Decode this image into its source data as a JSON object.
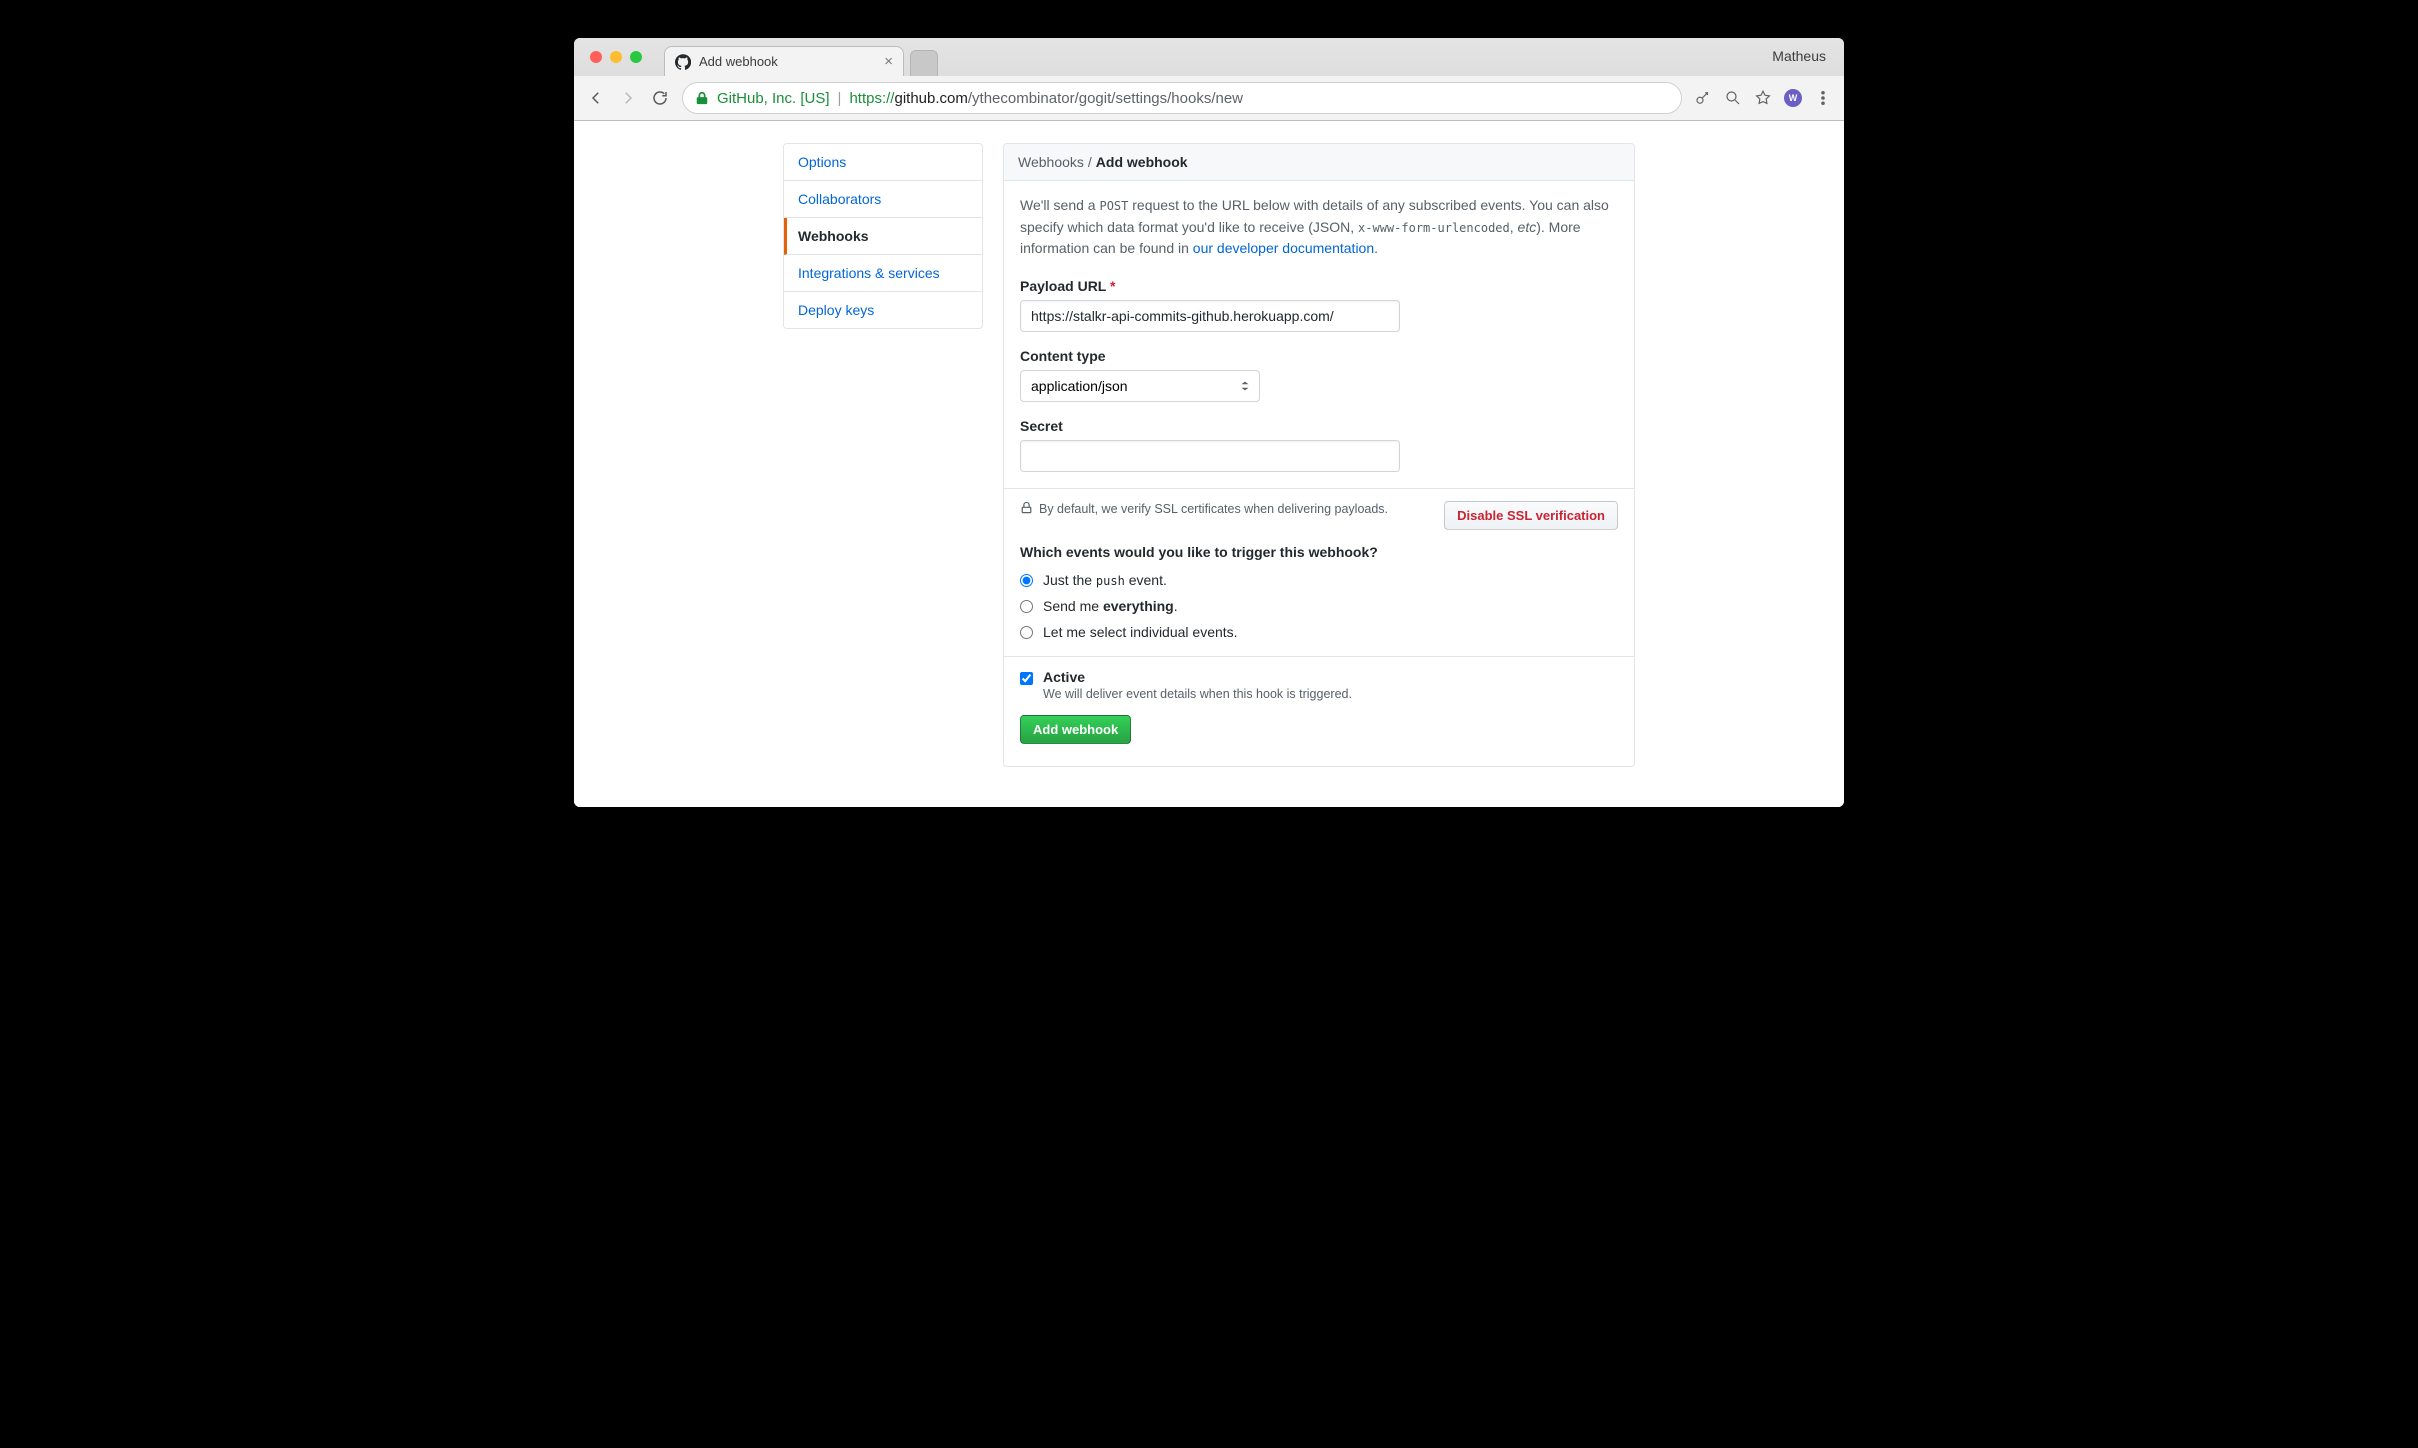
{
  "chrome": {
    "profile": "Matheus",
    "tab_title": "Add webhook",
    "ev_label": "GitHub, Inc. [US]",
    "url_proto": "https://",
    "url_host": "github.com",
    "url_path": "/ythecombinator/gogit/settings/hooks/new"
  },
  "sidebar": {
    "items": [
      {
        "label": "Options"
      },
      {
        "label": "Collaborators"
      },
      {
        "label": "Webhooks",
        "selected": true
      },
      {
        "label": "Integrations & services"
      },
      {
        "label": "Deploy keys"
      }
    ]
  },
  "breadcrumb": {
    "parent": "Webhooks",
    "sep": " / ",
    "current": "Add webhook"
  },
  "intro": {
    "p1a": "We'll send a ",
    "p1code": "POST",
    "p1b": " request to the URL below with details of any subscribed events. You can also specify which data format you'd like to receive (JSON, ",
    "p1code2": "x-www-form-urlencoded",
    "p1c": ", ",
    "p1em": "etc",
    "p1d": "). More information can be found in ",
    "link": "our developer documentation",
    "p1e": "."
  },
  "form": {
    "payload_url_label": "Payload URL",
    "payload_url_value": "https://stalkr-api-commits-github.herokuapp.com/",
    "content_type_label": "Content type",
    "content_type_value": "application/json",
    "secret_label": "Secret",
    "secret_value": "",
    "ssl_note": "By default, we verify SSL certificates when delivering payloads.",
    "disable_ssl_label": "Disable SSL verification",
    "events_question": "Which events would you like to trigger this webhook?",
    "evt1_a": "Just the ",
    "evt1_code": "push",
    "evt1_b": " event.",
    "evt2_a": "Send me ",
    "evt2_strong": "everything",
    "evt2_b": ".",
    "evt3": "Let me select individual events.",
    "active_label": "Active",
    "active_desc": "We will deliver event details when this hook is triggered.",
    "submit_label": "Add webhook"
  }
}
